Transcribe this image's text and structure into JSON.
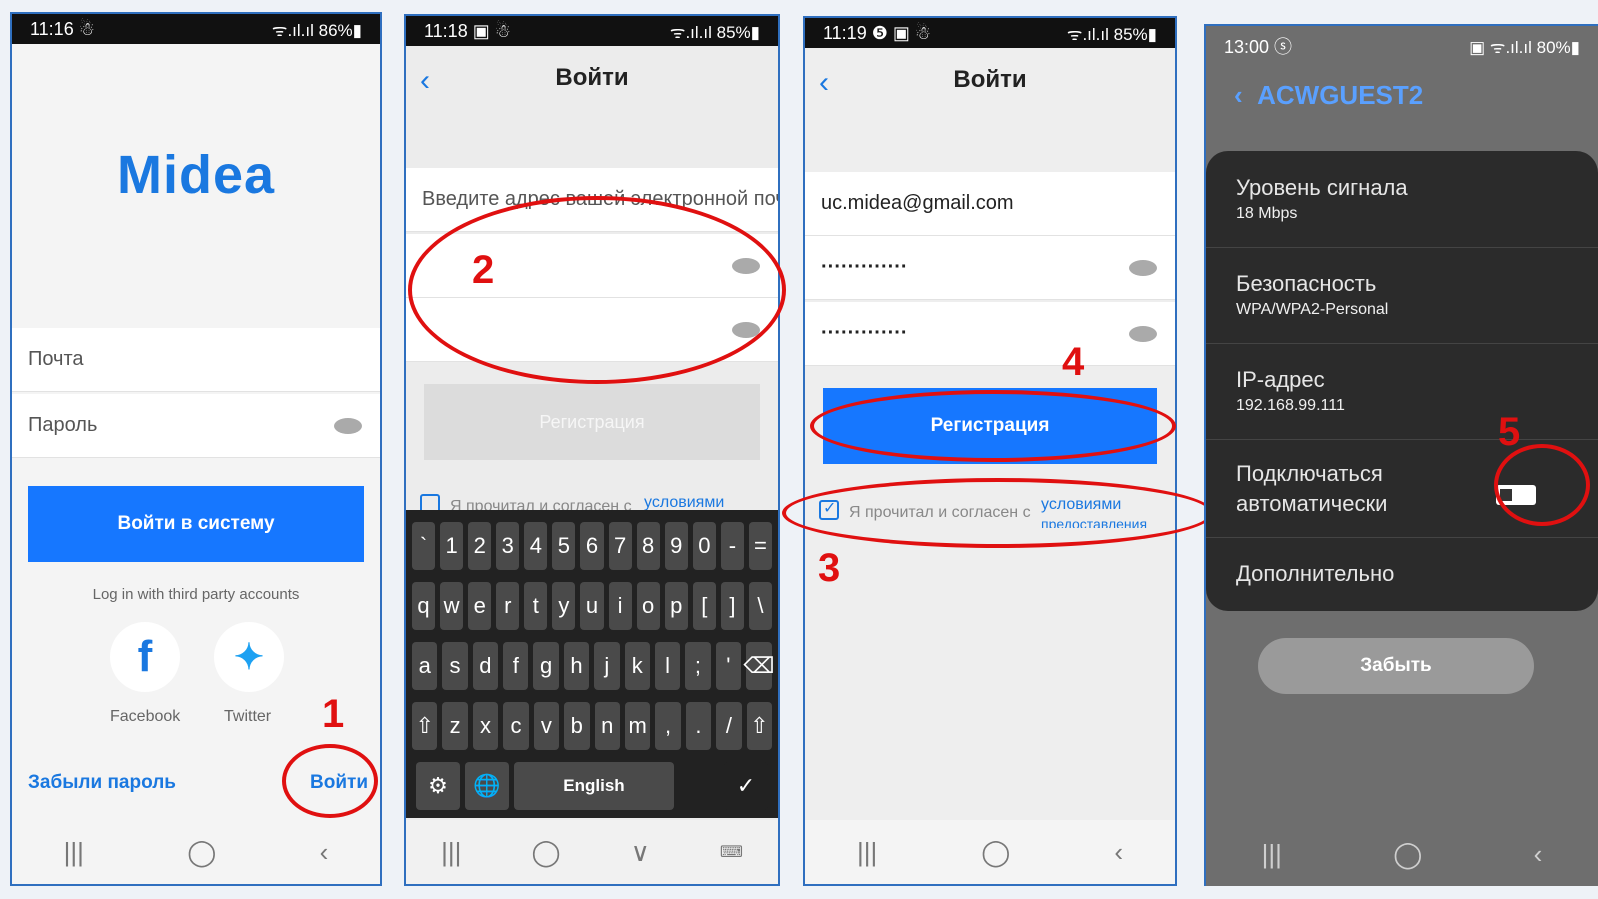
{
  "screen1": {
    "time": "11:16 ☃",
    "signal": "ᯤ.ıl.ıl 86%▮",
    "logo": "Midea",
    "email_placeholder": "Почта",
    "password_placeholder": "Пароль",
    "login_button": "Войти в систему",
    "third_party": "Log in with third party accounts",
    "facebook": "Facebook",
    "twitter": "Twitter",
    "forgot": "Забыли пароль",
    "login_link": "Войти",
    "marker": "1"
  },
  "screen2": {
    "time": "11:18 ▣ ☃",
    "signal": "ᯤ.ıl.ıl 85%▮",
    "title": "Войти",
    "email_placeholder": "Введите адрес вашей электронной поч",
    "register": "Регистрация",
    "terms_text": "Я прочитал и согласен с",
    "terms_link": "условиями",
    "marker": "2",
    "keys_row1": [
      "`",
      "1",
      "2",
      "3",
      "4",
      "5",
      "6",
      "7",
      "8",
      "9",
      "0",
      "-",
      "="
    ],
    "keys_row2": [
      "q",
      "w",
      "e",
      "r",
      "t",
      "y",
      "u",
      "i",
      "o",
      "p",
      "[",
      "]",
      "\\"
    ],
    "keys_row3": [
      "a",
      "s",
      "d",
      "f",
      "g",
      "h",
      "j",
      "k",
      "l",
      ";",
      "'",
      "⌫"
    ],
    "keys_row4": [
      "⇧",
      "z",
      "x",
      "c",
      "v",
      "b",
      "n",
      "m",
      ",",
      ".",
      "/",
      "⇧"
    ],
    "space": "English",
    "settings": "⚙",
    "globe": "🌐",
    "done": "✓"
  },
  "screen3": {
    "time": "11:19 ❺ ▣ ☃",
    "signal": "ᯤ.ıl.ıl 85%▮",
    "title": "Войти",
    "email": "uc.midea@gmail.com",
    "password": "·············",
    "password2": "·············",
    "register": "Регистрация",
    "terms_text": "Я прочитал и согласен с",
    "terms_link": "условиями",
    "terms_link2": "предоставления",
    "marker3": "3",
    "marker4": "4"
  },
  "screen4": {
    "time": "13:00 ⓢ",
    "signal": "▣ ᯤ.ıl.ıl 80%▮",
    "network": "ACWGUEST2",
    "signal_label": "Уровень сигнала",
    "signal_value": "18 Mbps",
    "security_label": "Безопасность",
    "security_value": "WPA/WPA2-Personal",
    "ip_label": "IP-адрес",
    "ip_value": "192.168.99.111",
    "auto_label1": "Подключаться",
    "auto_label2": "автоматически",
    "advanced": "Дополнительно",
    "forget": "Забыть",
    "marker": "5"
  },
  "nav": {
    "recent": "|||",
    "home": "◯",
    "back": "‹",
    "down": "∨",
    "kb": "⌨"
  },
  "colors": {
    "accent": "#1677ff",
    "marker": "#e01010",
    "frame": "#2f6fbf"
  }
}
